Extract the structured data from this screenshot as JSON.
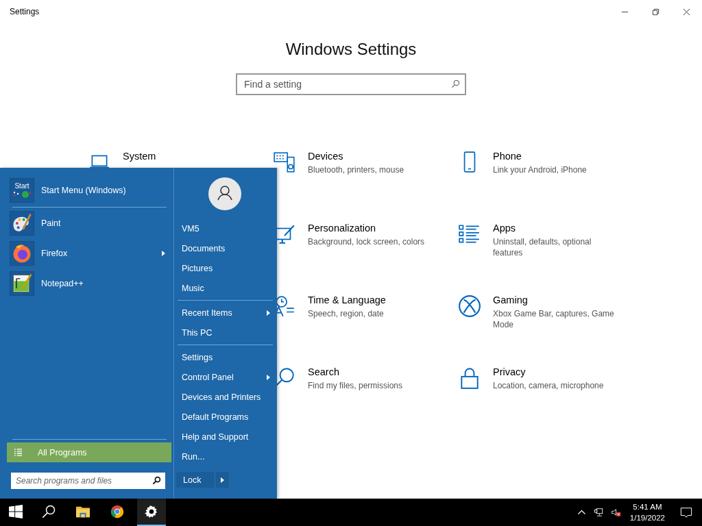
{
  "window": {
    "title": "Settings"
  },
  "heading": "Windows Settings",
  "search": {
    "placeholder": "Find a setting"
  },
  "category_columns": [
    [
      {
        "title": "System"
      }
    ],
    [
      {
        "title": "Devices",
        "description": "Bluetooth, printers, mouse"
      },
      {
        "title": "Personalization",
        "description": "Background, lock screen, colors"
      },
      {
        "title": "Time & Language",
        "description": "Speech, region, date"
      },
      {
        "title": "Search",
        "description": "Find my files, permissions"
      }
    ],
    [
      {
        "title": "Phone",
        "description": "Link your Android, iPhone"
      },
      {
        "title": "Apps",
        "description": "Uninstall, defaults, optional features"
      },
      {
        "title": "Gaming",
        "description": "Xbox Game Bar, captures, Game Mode"
      },
      {
        "title": "Privacy",
        "description": "Location, camera, microphone"
      }
    ]
  ],
  "start_menu": {
    "pinned": {
      "icon_text": "Start",
      "label": "Start Menu (Windows)"
    },
    "apps": [
      {
        "label": "Paint",
        "submenu": false
      },
      {
        "label": "Firefox",
        "submenu": true
      },
      {
        "label": "Notepad++",
        "submenu": false
      }
    ],
    "all_programs": "All Programs",
    "search": {
      "placeholder": "Search programs and files"
    },
    "link_groups": [
      [
        {
          "label": "VM5",
          "submenu": false
        },
        {
          "label": "Documents",
          "submenu": false
        },
        {
          "label": "Pictures",
          "submenu": false
        },
        {
          "label": "Music",
          "submenu": false
        }
      ],
      [
        {
          "label": "Recent Items",
          "submenu": true
        },
        {
          "label": "This PC",
          "submenu": false
        }
      ],
      [
        {
          "label": "Settings",
          "submenu": false
        },
        {
          "label": "Control Panel",
          "submenu": true
        },
        {
          "label": "Devices and Printers",
          "submenu": false
        },
        {
          "label": "Default Programs",
          "submenu": false
        },
        {
          "label": "Help and Support",
          "submenu": false
        },
        {
          "label": "Run...",
          "submenu": false
        }
      ]
    ],
    "lock": {
      "label": "Lock"
    }
  },
  "taskbar": {
    "items": [
      {
        "kind": "start",
        "active": false
      },
      {
        "kind": "search",
        "active": false
      },
      {
        "kind": "explorer",
        "active": false
      },
      {
        "kind": "chrome",
        "active": false
      },
      {
        "kind": "settings",
        "active": true
      }
    ],
    "tray": {
      "muted": true,
      "time": "5:41 AM",
      "date": "1/19/2022"
    }
  }
}
